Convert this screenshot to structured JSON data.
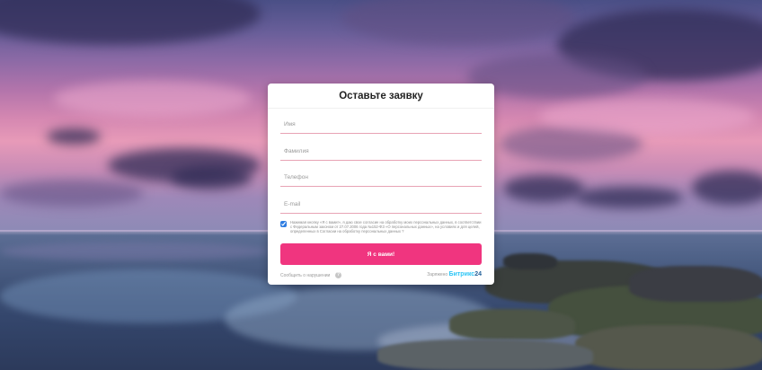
{
  "form": {
    "title": "Оставьте заявку",
    "fields": [
      {
        "name": "name",
        "placeholder": "Имя",
        "value": ""
      },
      {
        "name": "surname",
        "placeholder": "Фамилия",
        "value": ""
      },
      {
        "name": "phone",
        "placeholder": "Телефон",
        "value": ""
      },
      {
        "name": "email",
        "placeholder": "E-mail",
        "value": ""
      }
    ],
    "consent": {
      "checked": true,
      "text": "Нажимая кнопку «Я с вами!», я даю свое согласие на обработку моих персональных данных, в соответствии с Федеральным законом от 27.07.2006 года №152-ФЗ «О персональных данных», на условиях и для целей, определенных в Согласии на обработку персональных данных ?"
    },
    "submit_label": "Я с вами!",
    "report_link": "Сообщить о нарушении",
    "info_icon": "info-icon",
    "powered": {
      "prefix": "Заряжено",
      "brand_part1": "Битрикс",
      "brand_part2": "24"
    }
  },
  "colors": {
    "accent": "#f0357f",
    "field_underline": "#e8a3b5",
    "brand_cyan": "#2fc6f6",
    "brand_navy": "#215f98"
  }
}
